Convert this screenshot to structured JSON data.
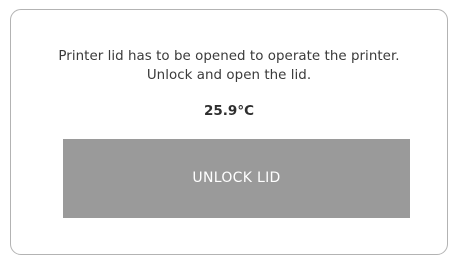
{
  "dialog": {
    "message_line1": "Printer lid has to be opened to operate the printer.",
    "message_line2": "Unlock and open the lid.",
    "temperature": "25.9°C",
    "unlock_button_label": "UNLOCK LID"
  },
  "colors": {
    "border": "#b3b3b3",
    "button_background": "#9a9a9a",
    "button_text": "#ffffff",
    "text": "#3a3a3a"
  }
}
